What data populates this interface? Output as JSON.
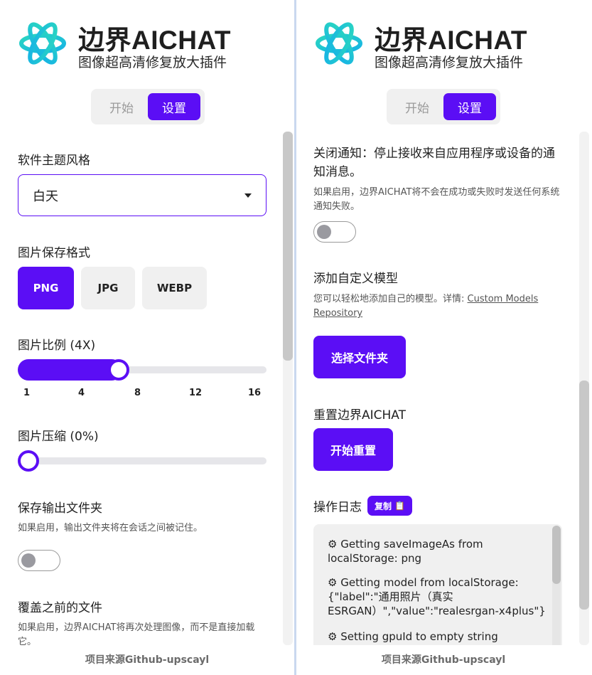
{
  "brand": {
    "title": "边界AICHAT",
    "subtitle": "图像超高清修复放大插件"
  },
  "tabs": [
    {
      "label": "开始",
      "active": false
    },
    {
      "label": "设置",
      "active": true
    }
  ],
  "footer": "项目来源Github-upscayl",
  "left": {
    "theme": {
      "label": "软件主题风格",
      "value": "白天"
    },
    "format": {
      "label": "图片保存格式",
      "options": [
        {
          "label": "PNG",
          "active": true
        },
        {
          "label": "JPG",
          "active": false
        },
        {
          "label": "WEBP",
          "active": false
        }
      ]
    },
    "scale": {
      "label": "图片比例 (4X)",
      "value": 4,
      "ticks": [
        "1",
        "4",
        "8",
        "12",
        "16"
      ]
    },
    "compression": {
      "label": "图片压缩 (0%)",
      "value": 0
    },
    "save_folder": {
      "label": "保存输出文件夹",
      "desc": "如果启用，输出文件夹将在会话之间被记住。",
      "enabled": false
    },
    "overwrite": {
      "label": "覆盖之前的文件",
      "desc": "如果启用，边界AICHAT将再次处理图像，而不是直接加载它。"
    }
  },
  "right": {
    "notifications": {
      "label": "关闭通知：停止接收来自应用程序或设备的通知消息。",
      "desc": "如果启用，边界AICHAT将不会在成功或失败时发送任何系统通知失败。",
      "enabled": false
    },
    "custom_models": {
      "label": "添加自定义模型",
      "desc_prefix": "您可以轻松地添加自己的模型。详情: ",
      "link": "Custom Models Repository",
      "button": "选择文件夹"
    },
    "reset": {
      "label": "重置边界AICHAT",
      "button": "开始重置"
    },
    "logs": {
      "label": "操作日志",
      "copy": "复制",
      "lines": [
        "Getting saveImageAs from localStorage: png",
        "Getting model from localStorage: {\"label\":\"通用照片（真实ESRGAN）\",\"value\":\"realesrgan-x4plus\"}",
        "Setting gpuId to empty string"
      ]
    }
  },
  "colors": {
    "accent": "#5b0ef5"
  }
}
